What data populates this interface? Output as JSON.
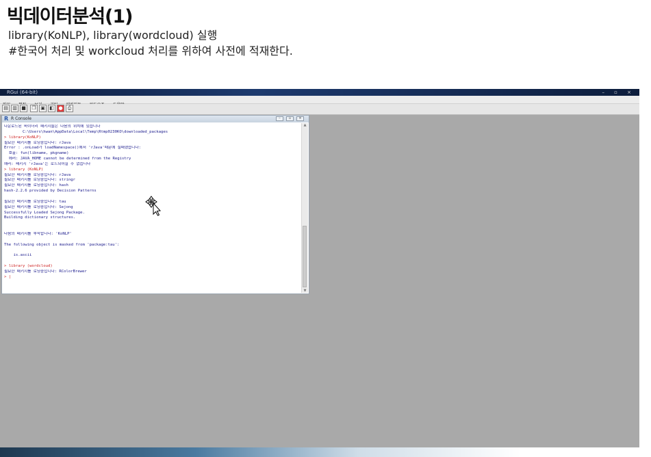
{
  "slide": {
    "title": "빅데이터분석(1)",
    "line1": "library(KoNLP),  library(wordcloud) 실행",
    "line2": "#한국어 처리 및 workcloud 처리를 위하여 사전에 적재한다."
  },
  "app": {
    "title": "RGui (64-bit)",
    "window_buttons": "– ▫ ×",
    "menu": [
      "파일",
      "편집",
      "보기",
      "기타",
      "패키지들",
      "윈도우즈",
      "도움말"
    ],
    "toolbar_icons": [
      "open-script-icon",
      "load-workspace-icon",
      "save-workspace-icon",
      "copy-icon",
      "paste-icon",
      "copy-paste-icon",
      "stop-icon",
      "print-icon"
    ]
  },
  "console": {
    "title": "R Console",
    "buttons": [
      "–",
      "▫",
      "×"
    ],
    "lines": [
      {
        "type": "out",
        "text": "다운로드된 바이너리 패키지들은 다음의 위치에 있습니다"
      },
      {
        "type": "out",
        "text": "        C:\\Users\\hwan\\AppData\\Local\\Temp\\Rtmp0230KO\\downloaded_packages"
      },
      {
        "type": "cmd",
        "text": "> library(KoNLP)"
      },
      {
        "type": "out",
        "text": "필요한 패키지를 로딩중입니다: rJava"
      },
      {
        "type": "out",
        "text": "Error : .onLoad가 loadNamespace()에서 'rJava'때문에 실패했습니다:"
      },
      {
        "type": "out",
        "text": "  호출: fun(libname, pkgname)"
      },
      {
        "type": "out",
        "text": "  에러: JAVA_HOME cannot be determined from the Registry"
      },
      {
        "type": "out",
        "text": "에러: 패키지 'rJava'는 로드되어질 수 없습니다"
      },
      {
        "type": "cmd",
        "text": "> library (KoNLP)"
      },
      {
        "type": "out",
        "text": "필요한 패키지를 로딩중입니다: rJava"
      },
      {
        "type": "out",
        "text": "필요한 패키지를 로딩중입니다: stringr"
      },
      {
        "type": "out",
        "text": "필요한 패키지를 로딩중입니다: hash"
      },
      {
        "type": "out",
        "text": "hash-2.2.6 provided by Decision Patterns"
      },
      {
        "type": "out",
        "text": ""
      },
      {
        "type": "out",
        "text": "필요한 패키지를 로딩중입니다: tau"
      },
      {
        "type": "out",
        "text": "필요한 패키지를 로딩중입니다: Sejong"
      },
      {
        "type": "out",
        "text": "Successfully Loaded Sejong Package."
      },
      {
        "type": "out",
        "text": "Building dictionary structures."
      },
      {
        "type": "out",
        "text": ""
      },
      {
        "type": "out",
        "text": ""
      },
      {
        "type": "out",
        "text": "다음의 패키지를 부착합니다: 'KoNLP'"
      },
      {
        "type": "out",
        "text": ""
      },
      {
        "type": "out",
        "text": "The following object is masked from 'package:tau':"
      },
      {
        "type": "out",
        "text": ""
      },
      {
        "type": "out",
        "text": "    is.ascii"
      },
      {
        "type": "out",
        "text": ""
      },
      {
        "type": "cmd",
        "text": "> library (wordcloud)"
      },
      {
        "type": "out",
        "text": "필요한 패키지를 로딩중입니다: RColorBrewer"
      },
      {
        "type": "cmd",
        "text": "> |"
      }
    ]
  }
}
